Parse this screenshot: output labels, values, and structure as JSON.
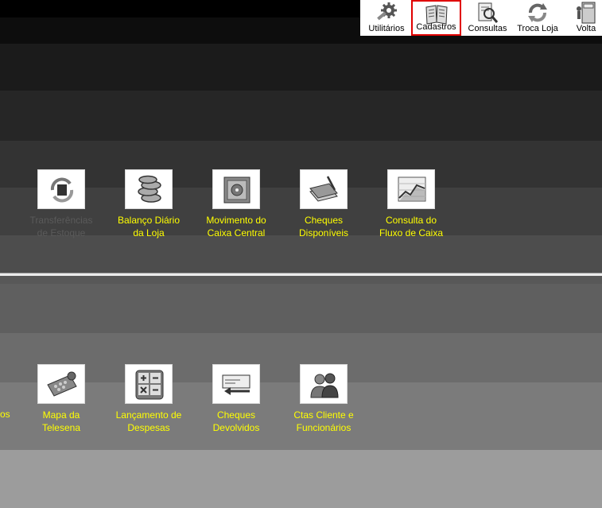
{
  "toolbar": {
    "buttons": [
      {
        "label": "Utilitários"
      },
      {
        "label": "Cadastros"
      },
      {
        "label": "Consultas"
      },
      {
        "label": "Troca Loja"
      },
      {
        "label": "Volta"
      }
    ]
  },
  "row1": [
    {
      "line1": "Transferências",
      "line2": "de Estoque",
      "icon": "transfer-icon"
    },
    {
      "line1": "Balanço Diário",
      "line2": "da Loja",
      "icon": "coins-icon"
    },
    {
      "line1": "Movimento do",
      "line2": "Caixa Central",
      "icon": "safe-icon"
    },
    {
      "line1": "Cheques",
      "line2": "Disponíveis",
      "icon": "checkbook-icon"
    },
    {
      "line1": "Consulta do",
      "line2": "Fluxo de Caixa",
      "icon": "chart-icon"
    }
  ],
  "row2": [
    {
      "line1": "Mapa da",
      "line2": "Telesena",
      "icon": "ticket-icon"
    },
    {
      "line1": "Lançamento de",
      "line2": "Despesas",
      "icon": "calculator-icon"
    },
    {
      "line1": "Cheques",
      "line2": "Devolvidos",
      "icon": "returned-check-icon"
    },
    {
      "line1": "Ctas Cliente e",
      "line2": "Funcionários",
      "icon": "people-icon"
    }
  ],
  "edge_text": "os",
  "colors": {
    "caption": "#ffff00",
    "disabled": "#5a5a5a",
    "selected_border": "#e00000"
  }
}
